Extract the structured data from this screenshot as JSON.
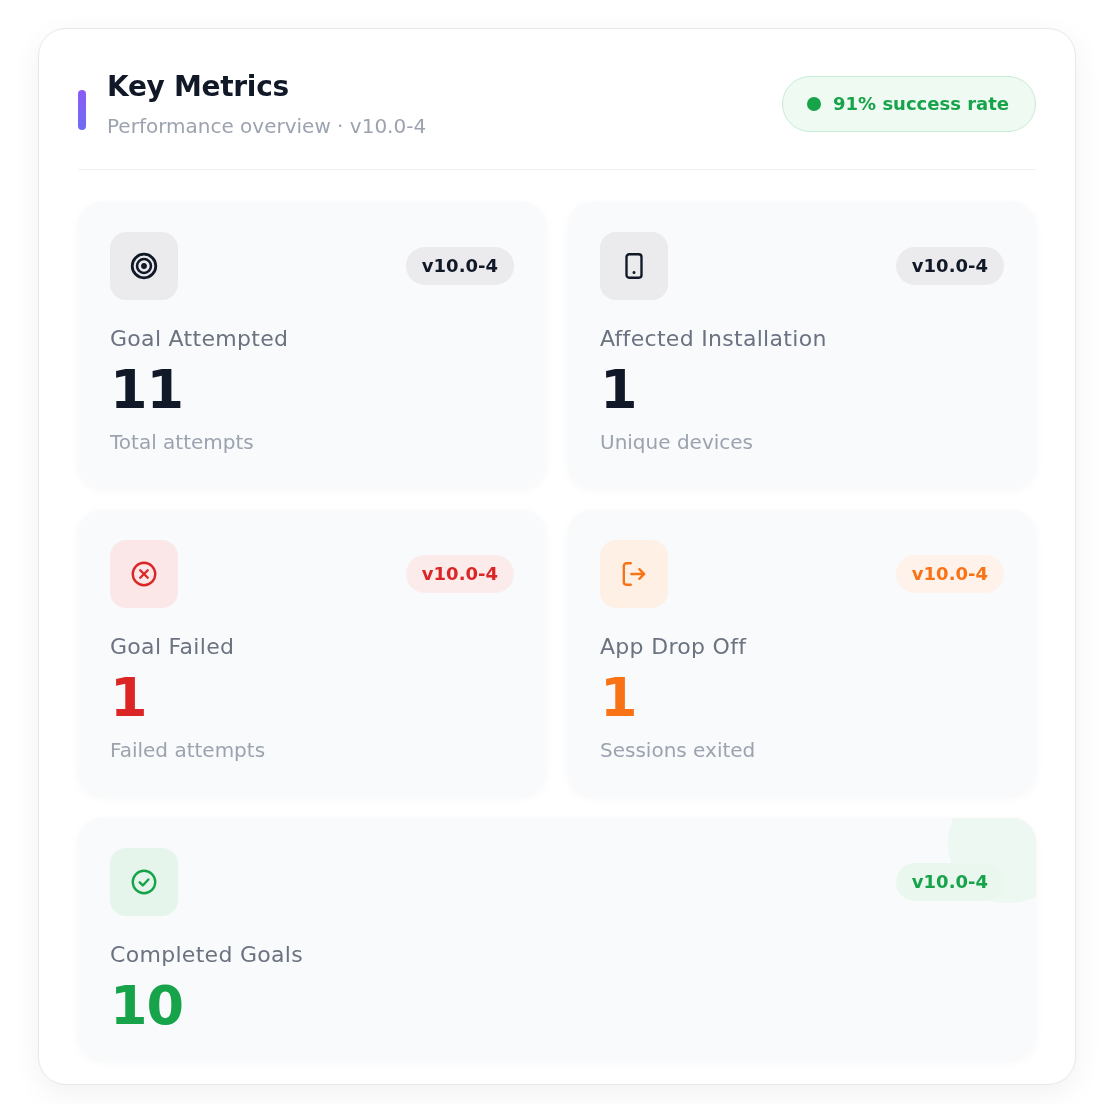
{
  "header": {
    "title": "Key Metrics",
    "subtitle": "Performance overview · v10.0-4",
    "badge": "91% success rate"
  },
  "metrics": [
    {
      "kind": "attempted",
      "label": "Goal Attempted",
      "value": "11",
      "caption": "Total attempts",
      "version": "v10.0-4",
      "color": "#111827"
    },
    {
      "kind": "installation",
      "label": "Affected Installation",
      "value": "1",
      "caption": "Unique devices",
      "version": "v10.0-4",
      "color": "#111827"
    },
    {
      "kind": "failed",
      "label": "Goal Failed",
      "value": "1",
      "caption": "Failed attempts",
      "version": "v10.0-4",
      "color": "#dc2626"
    },
    {
      "kind": "dropoff",
      "label": "App Drop Off",
      "value": "1",
      "caption": "Sessions exited",
      "version": "v10.0-4",
      "color": "#f97316"
    },
    {
      "kind": "completed",
      "label": "Completed Goals",
      "value": "10",
      "version": "v10.0-4",
      "color": "#16a34a"
    }
  ]
}
